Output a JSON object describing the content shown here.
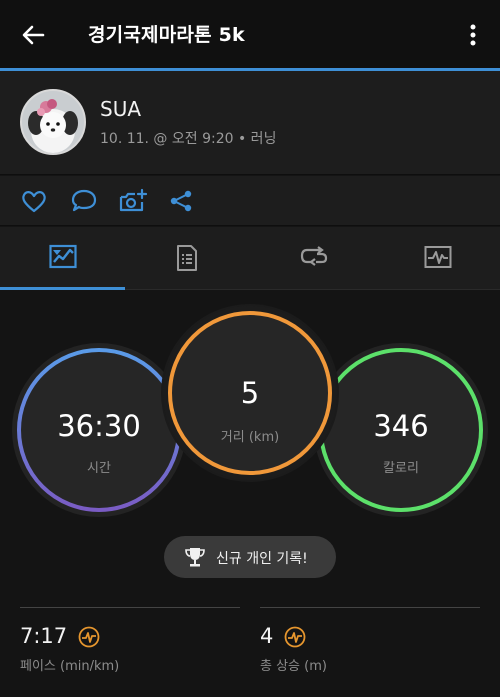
{
  "header": {
    "title": "경기국제마라톤 5k",
    "back_icon": "back-arrow-icon",
    "more_icon": "more-vertical-icon"
  },
  "activity": {
    "user_name": "SUA",
    "meta": "10. 11. @ 오전 9:20 • 러닝"
  },
  "actions": [
    {
      "name": "like",
      "icon": "heart-icon"
    },
    {
      "name": "comment",
      "icon": "comment-icon"
    },
    {
      "name": "add-photo",
      "icon": "camera-add-icon"
    },
    {
      "name": "share",
      "icon": "share-icon"
    }
  ],
  "tabs": [
    {
      "name": "overview",
      "icon": "map-icon",
      "active": true
    },
    {
      "name": "stats",
      "icon": "document-list-icon",
      "active": false
    },
    {
      "name": "laps",
      "icon": "laps-loop-icon",
      "active": false
    },
    {
      "name": "charts",
      "icon": "chart-icon",
      "active": false
    }
  ],
  "summary": {
    "time": {
      "value": "36:30",
      "label": "시간"
    },
    "distance": {
      "value": "5",
      "label": "거리 (km)"
    },
    "calories": {
      "value": "346",
      "label": "칼로리"
    }
  },
  "record_badge": "신규 개인 기록!",
  "stats": [
    {
      "value": "7:17",
      "label": "페이스 (min/km)",
      "icon": "garmin-connect-icon"
    },
    {
      "value": "4",
      "label": "총 상승 (m)",
      "icon": "garmin-connect-icon"
    }
  ],
  "colors": {
    "accent_blue": "#3e8fd6",
    "time_ring": [
      "#5a9be8",
      "#7a5cc4"
    ],
    "distance_ring": "#f0983a",
    "calories_ring": "#5ce06a",
    "badge_orange": "#e6962e"
  }
}
